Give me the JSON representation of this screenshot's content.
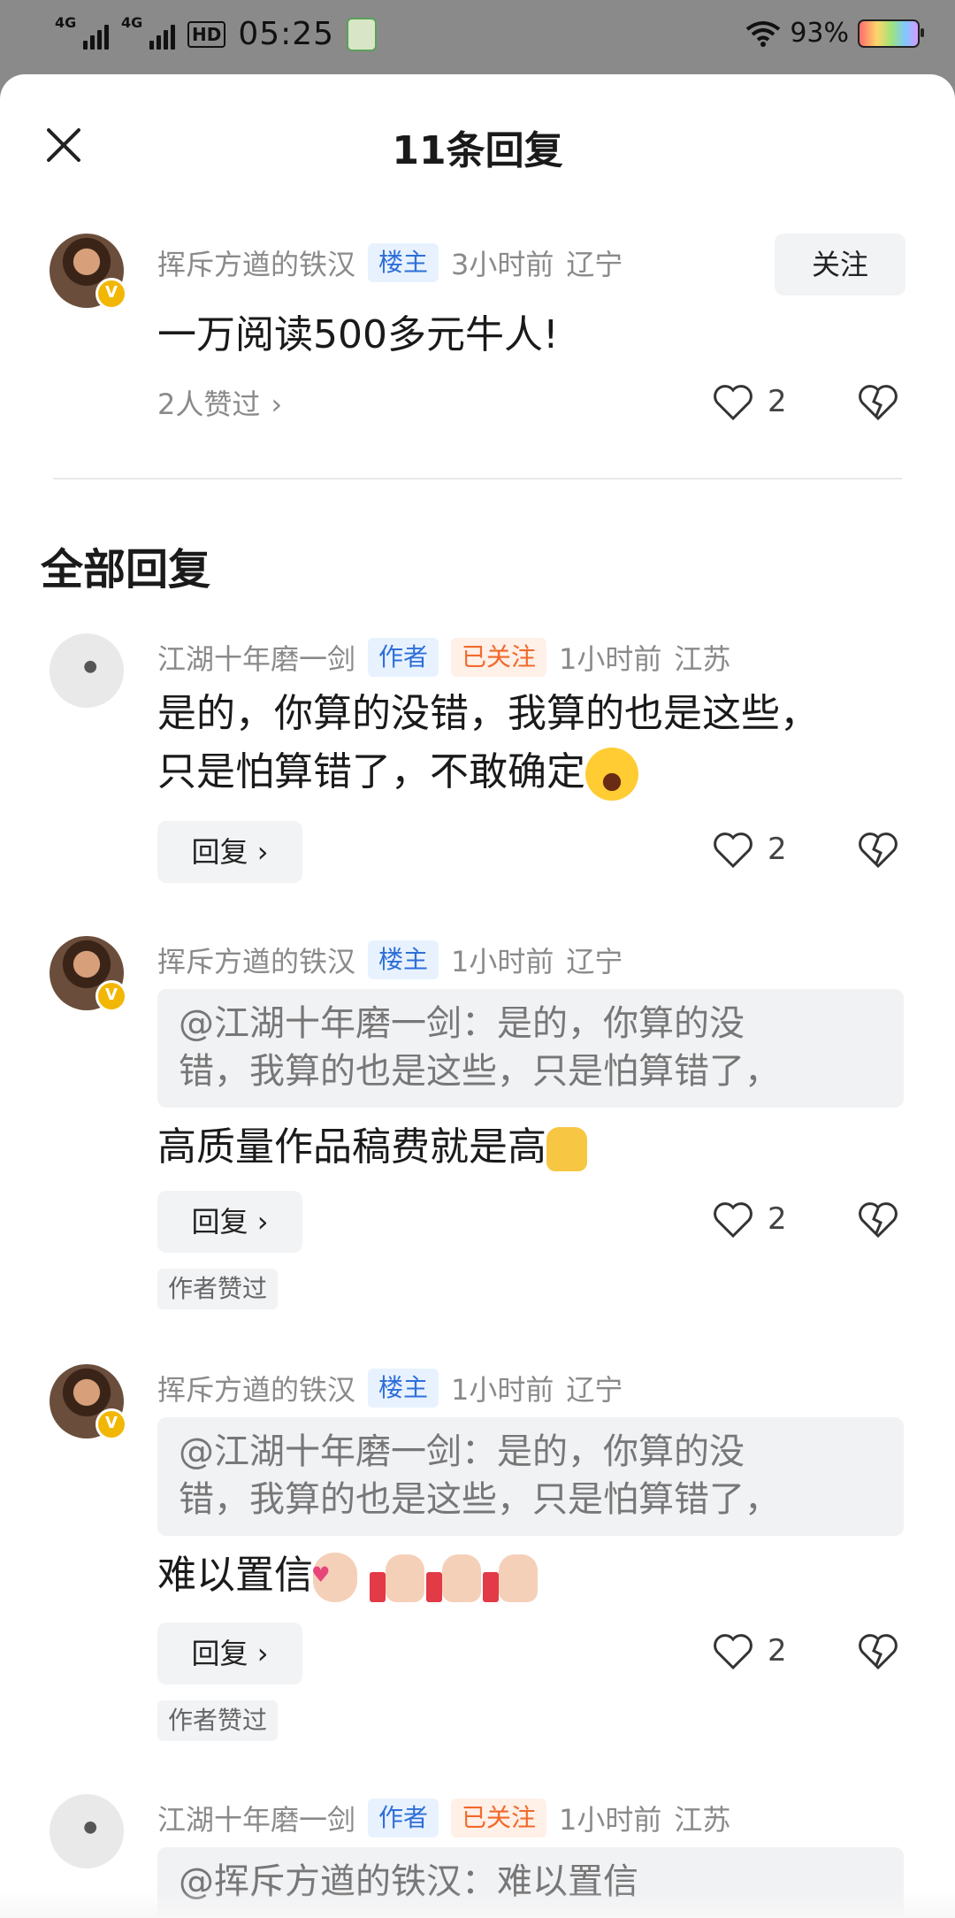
{
  "status": {
    "net1": "4G",
    "net2": "4G",
    "hd": "HD",
    "time": "05:25",
    "battery": "93%"
  },
  "header": {
    "title": "11条回复"
  },
  "main_comment": {
    "user": "挥斥方遒的铁汉",
    "tag": "楼主",
    "time": "3小时前",
    "location": "辽宁",
    "follow_label": "关注",
    "text": "一万阅读500多元牛人!",
    "liked_by": "2人赞过",
    "like_count": "2"
  },
  "section_title": "全部回复",
  "replies": [
    {
      "user": "江湖十年磨一剑",
      "tag": "作者",
      "followed": "已关注",
      "time": "1小时前",
      "location": "江苏",
      "line1": "是的，你算的没错，我算的也是这些，",
      "line2": "只是怕算错了，不敢确定",
      "reply_label": "回复",
      "like_count": "2"
    },
    {
      "user": "挥斥方遒的铁汉",
      "tag": "楼主",
      "time": "1小时前",
      "location": "辽宁",
      "quote1": "@江湖十年磨一剑：是的，你算的没",
      "quote2": "错，我算的也是这些，只是怕算错了，",
      "text": "高质量作品稿费就是高",
      "reply_label": "回复",
      "like_count": "2",
      "author_liked": "作者赞过"
    },
    {
      "user": "挥斥方遒的铁汉",
      "tag": "楼主",
      "time": "1小时前",
      "location": "辽宁",
      "quote1": "@江湖十年磨一剑：是的，你算的没",
      "quote2": "错，我算的也是这些，只是怕算错了，",
      "text": "难以置信",
      "reply_label": "回复",
      "like_count": "2",
      "author_liked": "作者赞过"
    },
    {
      "user": "江湖十年磨一剑",
      "tag": "作者",
      "followed": "已关注",
      "time": "1小时前",
      "location": "江苏",
      "quote1": "@挥斥方遒的铁汉：难以置信"
    }
  ]
}
